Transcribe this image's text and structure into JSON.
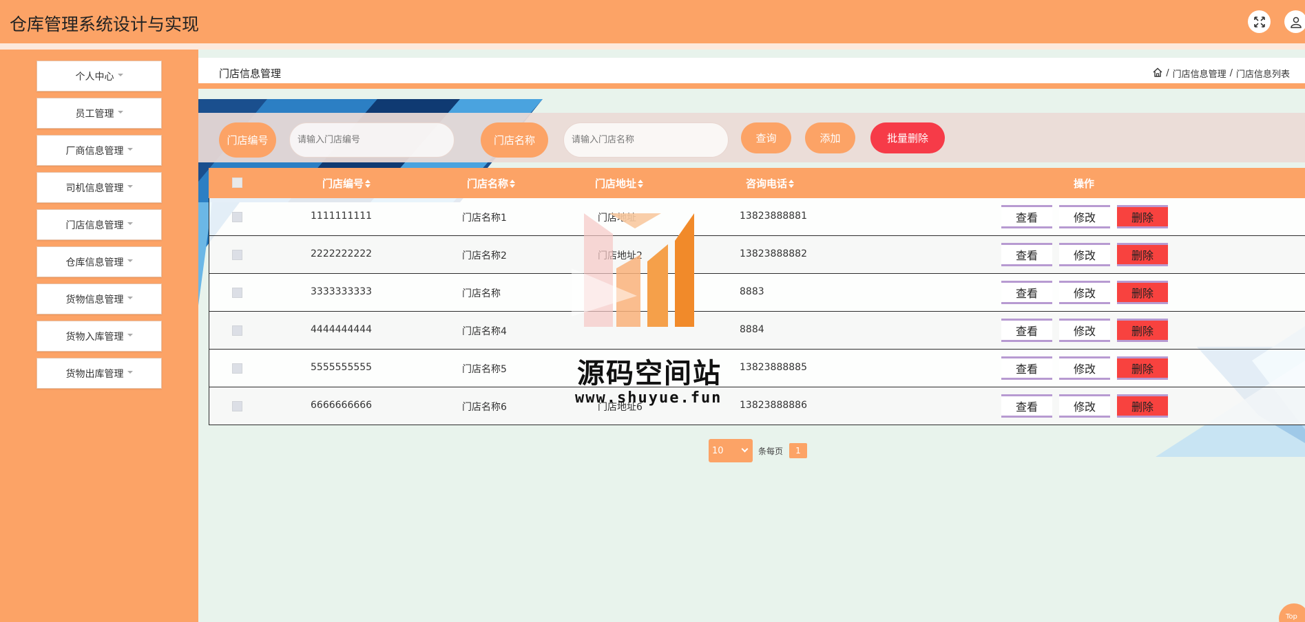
{
  "header": {
    "title": "仓库管理系统设计与实现"
  },
  "sidebar": {
    "items": [
      {
        "label": "个人中心"
      },
      {
        "label": "员工管理"
      },
      {
        "label": "厂商信息管理"
      },
      {
        "label": "司机信息管理"
      },
      {
        "label": "门店信息管理"
      },
      {
        "label": "仓库信息管理"
      },
      {
        "label": "货物信息管理"
      },
      {
        "label": "货物入库管理"
      },
      {
        "label": "货物出库管理"
      }
    ]
  },
  "page": {
    "title": "门店信息管理",
    "breadcrumb": [
      "门店信息管理",
      "门店信息列表"
    ],
    "breadcrumb_sep": "/"
  },
  "search": {
    "code_label": "门店编号",
    "code_placeholder": "请输入门店编号",
    "name_label": "门店名称",
    "name_placeholder": "请输入门店名称",
    "query_btn": "查询",
    "add_btn": "添加",
    "batch_delete_btn": "批量删除"
  },
  "table": {
    "columns": [
      "门店编号",
      "门店名称",
      "门店地址",
      "咨询电话",
      "操作"
    ],
    "actions": {
      "view": "查看",
      "edit": "修改",
      "delete": "删除"
    },
    "rows": [
      {
        "code": "1111111111",
        "name": "门店名称1",
        "address": "门店地址",
        "phone": "13823888881"
      },
      {
        "code": "2222222222",
        "name": "门店名称2",
        "address": "门店地址2",
        "phone": "13823888882"
      },
      {
        "code": "3333333333",
        "name": "门店名称",
        "address": "",
        "phone": "8883"
      },
      {
        "code": "4444444444",
        "name": "门店名称4",
        "address": "",
        "phone": "8884"
      },
      {
        "code": "5555555555",
        "name": "门店名称5",
        "address": "",
        "phone": "13823888885"
      },
      {
        "code": "6666666666",
        "name": "门店名称6",
        "address": "门店地址6",
        "phone": "13823888886"
      }
    ]
  },
  "pagination": {
    "page_size": "10",
    "per_page_text": "条每页",
    "current_page": "1"
  },
  "watermark": {
    "text": "源码空间站",
    "url": "www.shuyue.fun"
  },
  "back_to_top": "Top",
  "colors": {
    "primary": "#fca366",
    "danger": "#f8423f",
    "batch_delete": "#f63b48",
    "main_bg": "#e8f3ec"
  }
}
